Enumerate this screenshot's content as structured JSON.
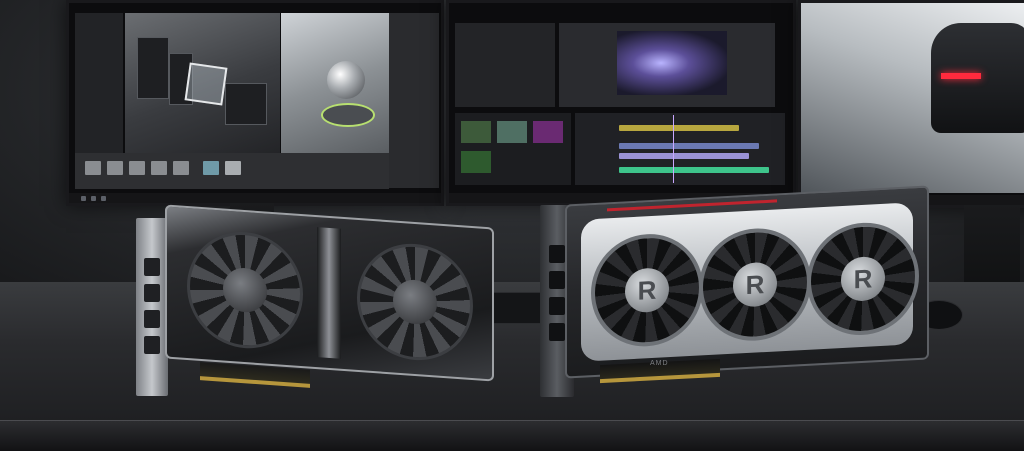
{
  "scene": {
    "monitors": [
      {
        "name": "left-monitor",
        "content": "3d-editor"
      },
      {
        "name": "middle-monitor",
        "content": "video-editor"
      },
      {
        "name": "right-monitor",
        "content": "render-view"
      }
    ],
    "gpus": [
      {
        "name": "gpu-left",
        "fans": 2
      },
      {
        "name": "gpu-right",
        "fans": 3,
        "fan_logo": "R",
        "pcb_text": "AMD"
      }
    ]
  }
}
